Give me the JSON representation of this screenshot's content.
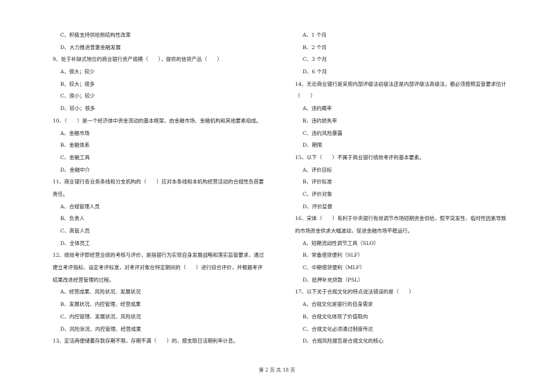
{
  "left_column": [
    {
      "type": "opt",
      "text": "C、积极支持供给侧结构性改革"
    },
    {
      "type": "opt",
      "text": "D、大力推进普惠金融发展"
    },
    {
      "type": "q",
      "text": "9、处于补缺式地位的商业银行资产规模（　　），提供的信贷产品（　　）"
    },
    {
      "type": "opt",
      "text": "A、很大；较少"
    },
    {
      "type": "opt",
      "text": "B、较大；很多"
    },
    {
      "type": "opt",
      "text": "C、很小；较少"
    },
    {
      "type": "opt",
      "text": "D、较小；很多"
    },
    {
      "type": "q",
      "text": "10、（　　）是一个经济体中资金流动的基本框架，由金融市场、金融机构和其他要素组成。"
    },
    {
      "type": "opt",
      "text": "A、金融市场"
    },
    {
      "type": "opt",
      "text": "B、金融体系"
    },
    {
      "type": "opt",
      "text": "C、金融工具"
    },
    {
      "type": "opt",
      "text": "D、金融中介"
    },
    {
      "type": "q",
      "text": "11、商业银行各业务条线和分支机构的（　　）应对本条线和本机构经营活动的合规性负首要"
    },
    {
      "type": "q",
      "text": "责任。"
    },
    {
      "type": "opt",
      "text": "A、合规管理人员"
    },
    {
      "type": "opt",
      "text": "B、负责人"
    },
    {
      "type": "opt",
      "text": "C、高管人员"
    },
    {
      "type": "opt",
      "text": "D、全体员工"
    },
    {
      "type": "q",
      "text": "12、绩效考评即经营业绩的考核与评价，是指银行为实现自身发展战略和落实监管要求，通过"
    },
    {
      "type": "q",
      "text": "建立考评指标、设定考评标准，对考评对象在特定期间的（　　）进行综合评价，并根据考评"
    },
    {
      "type": "q",
      "text": "结果改进经营管理的过程。"
    },
    {
      "type": "opt",
      "text": "A、经营成果、风险状况、发展状况"
    },
    {
      "type": "opt",
      "text": "B、发展状况、内控管理、经营成果"
    },
    {
      "type": "opt",
      "text": "C、内控管理、发展状况、风险状况"
    },
    {
      "type": "opt",
      "text": "D、风险状况、内控管理、经营成果"
    },
    {
      "type": "q",
      "text": "13、定活两便储蓄存款存期不限，存期不满（　　）的，按支取日活期利率计息。"
    }
  ],
  "right_column": [
    {
      "type": "opt",
      "text": "A、1 个月"
    },
    {
      "type": "opt",
      "text": "B、2 个月"
    },
    {
      "type": "opt",
      "text": "C、3 个月"
    },
    {
      "type": "opt",
      "text": "D、6 个月"
    },
    {
      "type": "q",
      "text": "14、无论商业银行是采用内部评级法初级法还是内部评级法高级法，都必须按照监管要求估计"
    },
    {
      "type": "q",
      "text": "（　　）"
    },
    {
      "type": "opt",
      "text": "A、违约概率"
    },
    {
      "type": "opt",
      "text": "B、违约损失率"
    },
    {
      "type": "opt",
      "text": "C、违约风险暴露"
    },
    {
      "type": "opt",
      "text": "D、期限"
    },
    {
      "type": "q",
      "text": "15、以下（　　）不属于商业银行绩效考评的基本要素。"
    },
    {
      "type": "opt",
      "text": "A、评价目标"
    },
    {
      "type": "opt",
      "text": "B、评价标准"
    },
    {
      "type": "opt",
      "text": "C、评价对象"
    },
    {
      "type": "opt",
      "text": "D、评价监督"
    },
    {
      "type": "q",
      "text": "16、宋体（　　）有利于中央银行有效调节市场短期资金供给，熨平突发性、临时性因素导致"
    },
    {
      "type": "q",
      "text": "的市场资金供求大幅波动，促进金融市场平稳运行。"
    },
    {
      "type": "opt",
      "text": "A、短期流动性调节工具（SLO）"
    },
    {
      "type": "opt",
      "text": "B、常备借贷便利（SLF）"
    },
    {
      "type": "opt",
      "text": "C、中期借贷便利（MLF）"
    },
    {
      "type": "opt",
      "text": "D、抵押补充贷款（PSL）"
    },
    {
      "type": "q",
      "text": "17、以下关于合规文化的特点说法错误的是（　　）"
    },
    {
      "type": "opt",
      "text": "A、合规文化是银行的自身需求"
    },
    {
      "type": "opt",
      "text": "B、合规文化体现了价值取向"
    },
    {
      "type": "opt",
      "text": "C、合规文化必须通过制度传达"
    },
    {
      "type": "opt",
      "text": "D、合规风险报告是合规文化的核心"
    }
  ],
  "footer": {
    "page_label": "第 2 页 共 18 页"
  }
}
